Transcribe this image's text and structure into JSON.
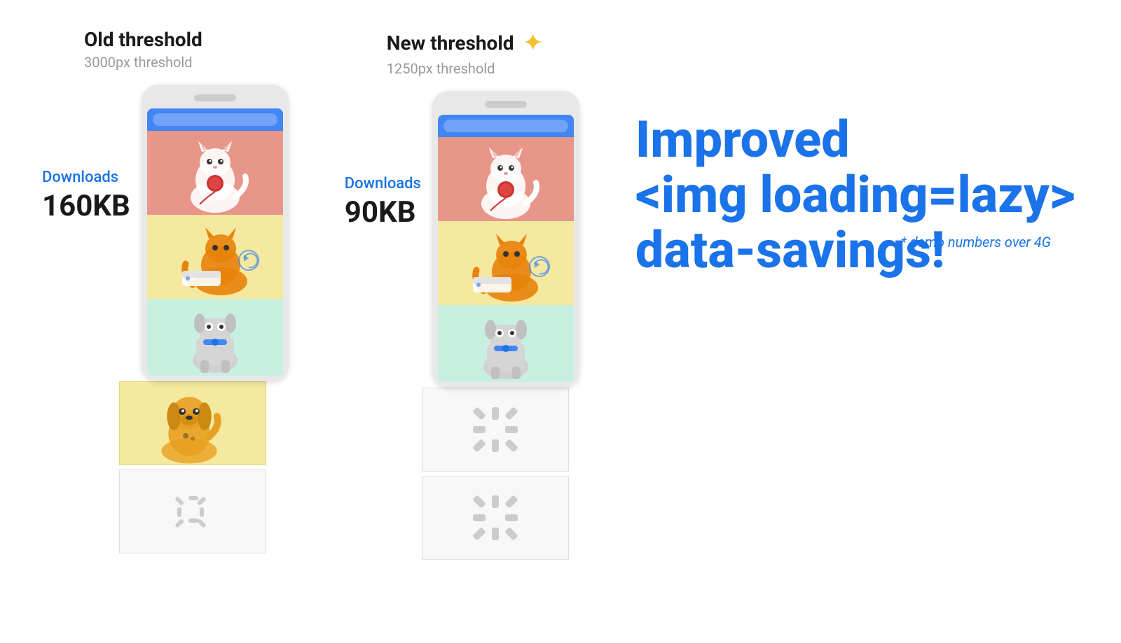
{
  "left_column": {
    "title": "Old threshold",
    "subtitle": "3000px threshold",
    "downloads_label": "Downloads",
    "downloads_size": "160KB"
  },
  "right_column": {
    "title": "New threshold",
    "subtitle": "1250px threshold",
    "sparkle": "✦",
    "downloads_label": "Downloads",
    "downloads_size": "90KB"
  },
  "headline": {
    "line1": "Improved",
    "line2": "<img loading=lazy>",
    "line3": "data-savings!"
  },
  "demo_note": "* demo numbers over 4G",
  "loading_icon": "⟳",
  "sparkle_emoji": "✦"
}
